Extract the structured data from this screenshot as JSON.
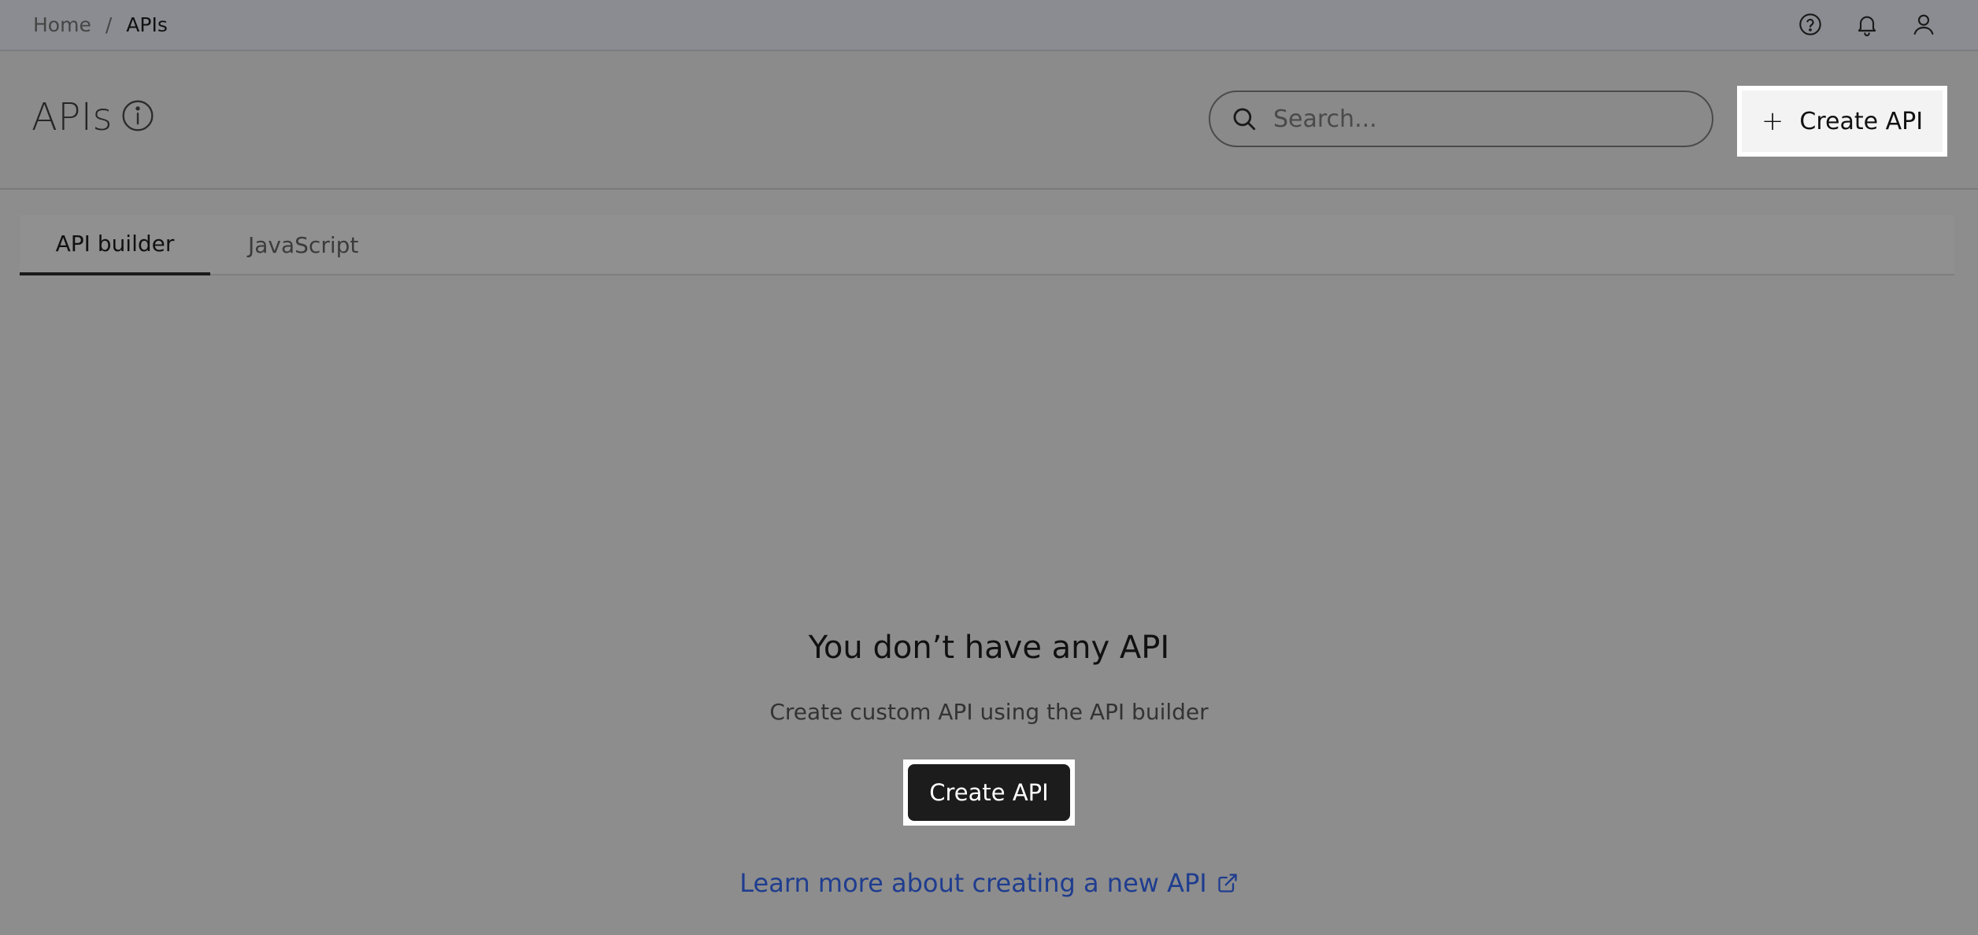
{
  "breadcrumb": {
    "home": "Home",
    "separator": "/",
    "current": "APIs"
  },
  "top_icons": [
    "help-circle-icon",
    "bell-icon",
    "user-icon"
  ],
  "header": {
    "title": "APIs",
    "search_placeholder": "Search...",
    "create_button_label": "Create API",
    "create_button_icon": "+"
  },
  "tabs": [
    {
      "label": "API builder",
      "active": true
    },
    {
      "label": "JavaScript",
      "active": false
    }
  ],
  "empty_state": {
    "title": "You don’t have any API",
    "subtitle": "Create custom API using the API builder",
    "button_label": "Create API",
    "link_text": "Learn more about creating a new API"
  },
  "colors": {
    "link": "#1f3d8f",
    "primary_button": "#1c1c1c"
  }
}
